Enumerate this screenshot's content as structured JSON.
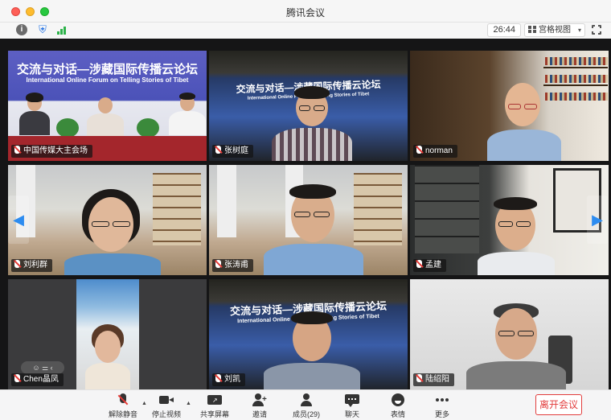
{
  "window": {
    "title": "腾讯会议"
  },
  "toolbar": {
    "timer": "26:44",
    "view_label": "宫格视图"
  },
  "slide": {
    "title_cn": "交流与对话—涉藏国际传播云论坛",
    "title_en": "International Online Forum on Telling Stories of Tibet",
    "caption": "中国传媒大学主会场"
  },
  "participants": [
    {
      "name": "中国传媒大主会场"
    },
    {
      "name": "张树庭"
    },
    {
      "name": "norman"
    },
    {
      "name": "刘利群"
    },
    {
      "name": "张涛甫"
    },
    {
      "name": "孟建"
    },
    {
      "name": "Chen晶凤"
    },
    {
      "name": "刘凯"
    },
    {
      "name": "陆绍阳"
    }
  ],
  "controls": [
    {
      "label": "解除静音",
      "icon": "mic-muted-icon"
    },
    {
      "label": "停止视频",
      "icon": "camera-icon"
    },
    {
      "label": "共享屏幕",
      "icon": "share-screen-icon"
    },
    {
      "label": "邀请",
      "icon": "invite-icon"
    },
    {
      "label": "成员(29)",
      "icon": "members-icon"
    },
    {
      "label": "聊天",
      "icon": "chat-icon"
    },
    {
      "label": "表情",
      "icon": "emoji-icon"
    },
    {
      "label": "更多",
      "icon": "more-icon"
    }
  ],
  "leave_label": "离开会议",
  "colors": {
    "accent": "#2d8cf0",
    "danger": "#e23c3c",
    "signal": "#2db34a"
  }
}
